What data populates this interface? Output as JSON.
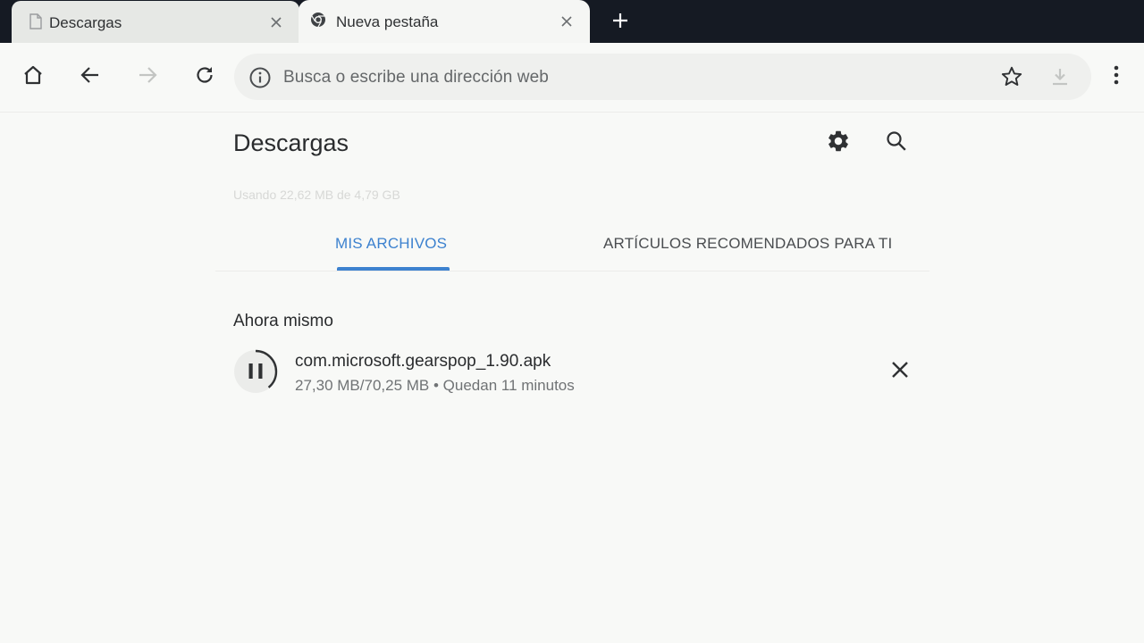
{
  "browser": {
    "tabs": [
      {
        "title": "Descargas",
        "icon": "page-icon",
        "active": false
      },
      {
        "title": "Nueva pestaña",
        "icon": "chrome-icon",
        "active": true
      }
    ],
    "new_tab_icon": "plus-icon"
  },
  "toolbar": {
    "home_icon": "home-icon",
    "back_icon": "arrow-left-icon",
    "forward_icon": "arrow-right-icon",
    "reload_icon": "reload-icon",
    "omnibox": {
      "placeholder": "Busca o escribe una dirección web",
      "info_icon": "info-icon",
      "star_icon": "star-icon",
      "download_icon": "download-icon"
    },
    "menu_icon": "more-vert-icon"
  },
  "page": {
    "title": "Descargas",
    "settings_icon": "gear-icon",
    "search_icon": "search-icon",
    "storage_text": "Usando 22,62 MB de 4,79 GB",
    "tabs": [
      {
        "label": "MIS ARCHIVOS",
        "selected": true
      },
      {
        "label": "ARTÍCULOS RECOMENDADOS PARA TI",
        "selected": false
      }
    ],
    "section_label": "Ahora mismo",
    "downloads": [
      {
        "file_name": "com.microsoft.gearspop_1.90.apk",
        "status": "27,30 MB/70,25 MB • Quedan 11 minutos",
        "progress": 0.39,
        "state": "paused-button-shown"
      }
    ]
  },
  "colors": {
    "accent": "#3d82cf",
    "tabstrip": "#151a23",
    "background": "#f8f9f7"
  }
}
